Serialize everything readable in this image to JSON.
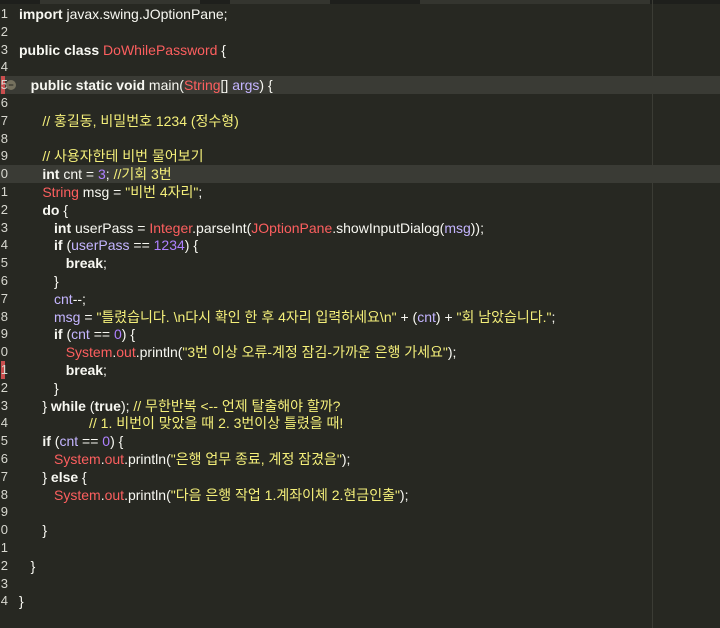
{
  "editor": {
    "language": "java",
    "theme_colors": {
      "background": "#272822",
      "highlight_line": "#3a3b35",
      "keyword": "#f8f8f2",
      "class_name": "#fd5f5f",
      "string": "#f4ef7a",
      "comment": "#f4ef7a",
      "number": "#ae81ff",
      "variable": "#c4b5ff"
    },
    "lines": [
      {
        "n": "1",
        "hl": false,
        "tokens": [
          [
            "kw",
            "import"
          ],
          [
            "pl",
            " javax.swing.JOptionPane;"
          ]
        ]
      },
      {
        "n": "2",
        "hl": false,
        "tokens": []
      },
      {
        "n": "3",
        "hl": false,
        "tokens": [
          [
            "kw",
            "public class"
          ],
          [
            "pl",
            " "
          ],
          [
            "cls",
            "DoWhilePassword"
          ],
          [
            "pl",
            " {"
          ]
        ]
      },
      {
        "n": "4",
        "hl": false,
        "tokens": []
      },
      {
        "n": "5",
        "hl": true,
        "marker": true,
        "fold": true,
        "tokens": [
          [
            "pl",
            "   "
          ],
          [
            "kw",
            "public static void"
          ],
          [
            "pl",
            " main("
          ],
          [
            "cls",
            "String"
          ],
          [
            "pl",
            "[] "
          ],
          [
            "var",
            "args"
          ],
          [
            "pl",
            ") {"
          ]
        ]
      },
      {
        "n": "6",
        "hl": false,
        "tokens": []
      },
      {
        "n": "7",
        "hl": false,
        "tokens": [
          [
            "pl",
            "      "
          ],
          [
            "cmt",
            "// 홍길동, 비밀번호 1234 (정수형)"
          ]
        ]
      },
      {
        "n": "8",
        "hl": false,
        "tokens": []
      },
      {
        "n": "9",
        "hl": false,
        "tokens": [
          [
            "pl",
            "      "
          ],
          [
            "cmt",
            "// 사용자한테 비번 물어보기"
          ]
        ]
      },
      {
        "n": "0",
        "hl": true,
        "tokens": [
          [
            "pl",
            "      "
          ],
          [
            "kw",
            "int"
          ],
          [
            "pl",
            " cnt = "
          ],
          [
            "num",
            "3"
          ],
          [
            "pl",
            "; "
          ],
          [
            "cmt",
            "//기회 3번"
          ]
        ]
      },
      {
        "n": "1",
        "hl": false,
        "tokens": [
          [
            "pl",
            "      "
          ],
          [
            "cls",
            "String"
          ],
          [
            "pl",
            " msg = "
          ],
          [
            "str",
            "\"비번 4자리\""
          ],
          [
            "pl",
            ";"
          ]
        ]
      },
      {
        "n": "2",
        "hl": false,
        "tokens": [
          [
            "pl",
            "      "
          ],
          [
            "kw",
            "do"
          ],
          [
            "pl",
            " {"
          ]
        ]
      },
      {
        "n": "3",
        "hl": false,
        "tokens": [
          [
            "pl",
            "         "
          ],
          [
            "kw",
            "int"
          ],
          [
            "pl",
            " userPass = "
          ],
          [
            "cls",
            "Integer"
          ],
          [
            "pl",
            ".parseInt("
          ],
          [
            "cls",
            "JOptionPane"
          ],
          [
            "pl",
            ".showInputDialog("
          ],
          [
            "var",
            "msg"
          ],
          [
            "pl",
            "));"
          ]
        ]
      },
      {
        "n": "4",
        "hl": false,
        "tokens": [
          [
            "pl",
            "         "
          ],
          [
            "kw",
            "if"
          ],
          [
            "pl",
            " ("
          ],
          [
            "var",
            "userPass"
          ],
          [
            "pl",
            " == "
          ],
          [
            "num",
            "1234"
          ],
          [
            "pl",
            ") {"
          ]
        ]
      },
      {
        "n": "5",
        "hl": false,
        "tokens": [
          [
            "pl",
            "            "
          ],
          [
            "kw",
            "break"
          ],
          [
            "pl",
            ";"
          ]
        ]
      },
      {
        "n": "6",
        "hl": false,
        "tokens": [
          [
            "pl",
            "         }"
          ]
        ]
      },
      {
        "n": "7",
        "hl": false,
        "tokens": [
          [
            "pl",
            "         "
          ],
          [
            "var",
            "cnt"
          ],
          [
            "pl",
            "--;"
          ]
        ]
      },
      {
        "n": "8",
        "hl": false,
        "tokens": [
          [
            "pl",
            "         "
          ],
          [
            "var",
            "msg"
          ],
          [
            "pl",
            " = "
          ],
          [
            "str",
            "\"틀렸습니다. \\n다시 확인 한 후 4자리 입력하세요\\n\""
          ],
          [
            "pl",
            " + ("
          ],
          [
            "var",
            "cnt"
          ],
          [
            "pl",
            ") + "
          ],
          [
            "str",
            "\"회 남았습니다.\""
          ],
          [
            "pl",
            ";"
          ]
        ]
      },
      {
        "n": "9",
        "hl": false,
        "tokens": [
          [
            "pl",
            "         "
          ],
          [
            "kw",
            "if"
          ],
          [
            "pl",
            " ("
          ],
          [
            "var",
            "cnt"
          ],
          [
            "pl",
            " == "
          ],
          [
            "num",
            "0"
          ],
          [
            "pl",
            ") {"
          ]
        ]
      },
      {
        "n": "0",
        "hl": false,
        "tokens": [
          [
            "pl",
            "            "
          ],
          [
            "cls",
            "System"
          ],
          [
            "pl",
            "."
          ],
          [
            "cls",
            "out"
          ],
          [
            "pl",
            ".println("
          ],
          [
            "str",
            "\"3번 이상 오류-계정 잠김-가까운 은행 가세요\""
          ],
          [
            "pl",
            ");"
          ]
        ]
      },
      {
        "n": "1",
        "hl": false,
        "marker": true,
        "tokens": [
          [
            "pl",
            "            "
          ],
          [
            "kw",
            "break"
          ],
          [
            "pl",
            ";"
          ]
        ]
      },
      {
        "n": "2",
        "hl": false,
        "tokens": [
          [
            "pl",
            "         }"
          ]
        ]
      },
      {
        "n": "3",
        "hl": false,
        "tokens": [
          [
            "pl",
            "      } "
          ],
          [
            "kw",
            "while"
          ],
          [
            "pl",
            " ("
          ],
          [
            "kw",
            "true"
          ],
          [
            "pl",
            "); "
          ],
          [
            "cmt",
            "// 무한반복 <-- 언제 탈출해야 할까?"
          ]
        ]
      },
      {
        "n": "4",
        "hl": false,
        "tokens": [
          [
            "pl",
            "                  "
          ],
          [
            "cmt",
            "// 1. 비번이 맞았을 때 2. 3번이상 틀렸을 때!"
          ]
        ]
      },
      {
        "n": "5",
        "hl": false,
        "tokens": [
          [
            "pl",
            "      "
          ],
          [
            "kw",
            "if"
          ],
          [
            "pl",
            " ("
          ],
          [
            "var",
            "cnt"
          ],
          [
            "pl",
            " == "
          ],
          [
            "num",
            "0"
          ],
          [
            "pl",
            ") {"
          ]
        ]
      },
      {
        "n": "6",
        "hl": false,
        "tokens": [
          [
            "pl",
            "         "
          ],
          [
            "cls",
            "System"
          ],
          [
            "pl",
            "."
          ],
          [
            "cls",
            "out"
          ],
          [
            "pl",
            ".println("
          ],
          [
            "str",
            "\"은행 업무 종료, 계정 잠겼음\""
          ],
          [
            "pl",
            ");"
          ]
        ]
      },
      {
        "n": "7",
        "hl": false,
        "tokens": [
          [
            "pl",
            "      } "
          ],
          [
            "kw",
            "else"
          ],
          [
            "pl",
            " {"
          ]
        ]
      },
      {
        "n": "8",
        "hl": false,
        "tokens": [
          [
            "pl",
            "         "
          ],
          [
            "cls",
            "System"
          ],
          [
            "pl",
            "."
          ],
          [
            "cls",
            "out"
          ],
          [
            "pl",
            ".println("
          ],
          [
            "str",
            "\"다음 은행 작업 1.계좌이체 2.현금인출\""
          ],
          [
            "pl",
            ");"
          ]
        ]
      },
      {
        "n": "9",
        "hl": false,
        "tokens": []
      },
      {
        "n": "0",
        "hl": false,
        "tokens": [
          [
            "pl",
            "      }"
          ]
        ]
      },
      {
        "n": "1",
        "hl": false,
        "tokens": []
      },
      {
        "n": "2",
        "hl": false,
        "tokens": [
          [
            "pl",
            "   }"
          ]
        ]
      },
      {
        "n": "3",
        "hl": false,
        "tokens": []
      },
      {
        "n": "4",
        "hl": false,
        "tokens": [
          [
            "pl",
            "}"
          ]
        ]
      }
    ]
  }
}
